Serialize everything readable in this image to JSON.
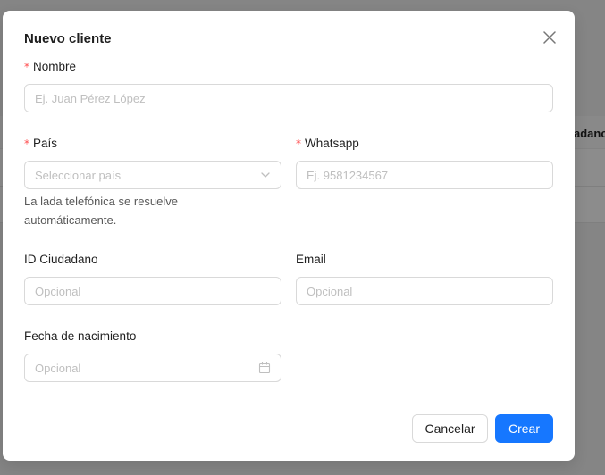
{
  "background": {
    "table_header_partial": "adanc"
  },
  "modal": {
    "title": "Nuevo cliente",
    "fields": {
      "nombre": {
        "label": "Nombre",
        "required": true,
        "placeholder": "Ej. Juan Pérez López"
      },
      "pais": {
        "label": "País",
        "required": true,
        "placeholder": "Seleccionar país",
        "help": "La lada telefónica se resuelve automáticamente."
      },
      "whatsapp": {
        "label": "Whatsapp",
        "required": true,
        "placeholder": "Ej. 9581234567"
      },
      "id_ciudadano": {
        "label": "ID Ciudadano",
        "placeholder": "Opcional"
      },
      "email": {
        "label": "Email",
        "placeholder": "Opcional"
      },
      "fecha_nacimiento": {
        "label": "Fecha de nacimiento",
        "placeholder": "Opcional"
      }
    },
    "buttons": {
      "cancel": "Cancelar",
      "create": "Crear"
    }
  },
  "colors": {
    "primary": "#1677ff",
    "required_mark": "#ff4d4f",
    "border": "#d9d9d9",
    "placeholder": "#bfbfbf"
  },
  "icons": {
    "close": "close-icon",
    "select_arrow": "chevron-down-icon",
    "date": "calendar-icon"
  }
}
